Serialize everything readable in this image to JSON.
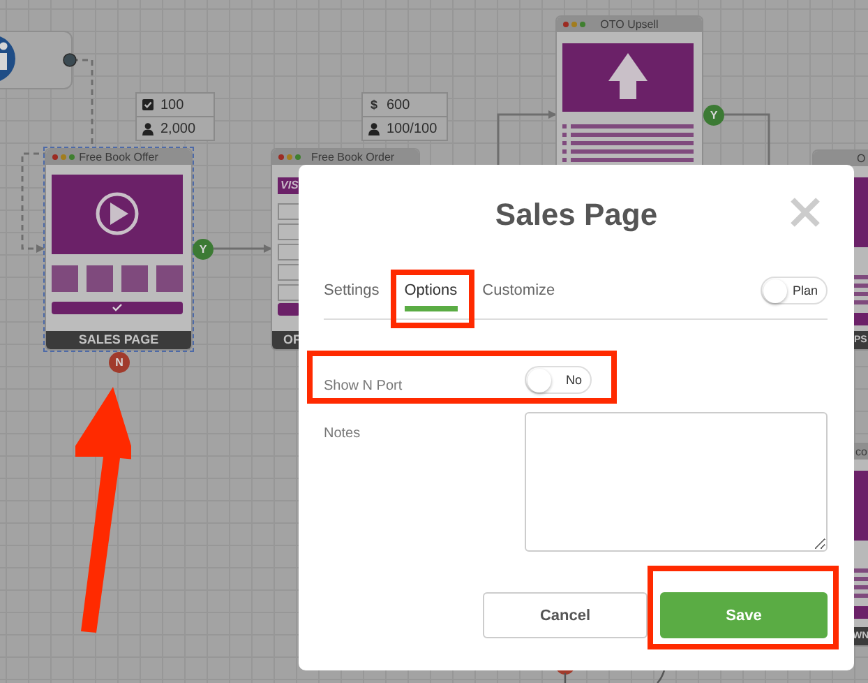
{
  "canvas": {
    "nodes": [
      {
        "title": "Free Book Offer",
        "footer": "SALES PAGE",
        "kind": "video",
        "selected": true
      },
      {
        "title": "Free Book Order",
        "footer": "OF",
        "kind": "order",
        "selected": false,
        "banner": "VIS"
      },
      {
        "title": "OTO Upsell",
        "kind": "upsell",
        "selected": false
      },
      {
        "title": "O",
        "footer": "PS",
        "kind": "edge",
        "selected": false
      },
      {
        "title": "co",
        "footer": "WN",
        "kind": "edge",
        "selected": false
      }
    ],
    "stats": [
      {
        "rows": [
          {
            "kind": "check",
            "value": "100"
          },
          {
            "kind": "person",
            "value": "2,000"
          }
        ]
      },
      {
        "rows": [
          {
            "kind": "currency",
            "symbol": "$",
            "value": "600"
          },
          {
            "kind": "person",
            "value": "100/100"
          }
        ]
      }
    ],
    "ports": [
      {
        "label": "Y",
        "kind": "yes"
      },
      {
        "label": "N",
        "kind": "no"
      },
      {
        "label": "Y",
        "kind": "yes"
      }
    ]
  },
  "dialog": {
    "title": "Sales Page",
    "tabs": [
      {
        "label": "Settings",
        "selected": false
      },
      {
        "label": "Options",
        "selected": true
      },
      {
        "label": "Customize",
        "selected": false
      }
    ],
    "plan_toggle": {
      "label": "Plan",
      "on": false
    },
    "fields": [
      {
        "kind": "toggle",
        "label": "Show N Port",
        "value": "No",
        "on": false
      },
      {
        "kind": "textarea",
        "label": "Notes"
      }
    ],
    "buttons": [
      {
        "label": "Cancel",
        "kind": "secondary"
      },
      {
        "label": "Save",
        "kind": "primary"
      }
    ]
  }
}
